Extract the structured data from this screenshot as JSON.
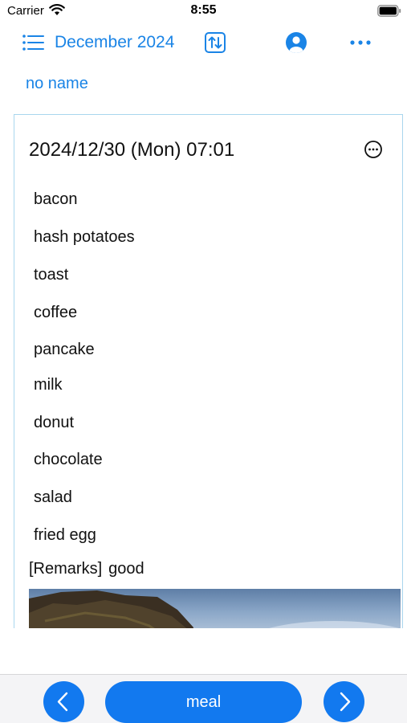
{
  "status_bar": {
    "carrier": "Carrier",
    "time": "8:55"
  },
  "header": {
    "month_title": "December 2024",
    "icons": [
      "list-icon",
      "sort-icon",
      "person-icon",
      "more-icon"
    ]
  },
  "name_link": "no name",
  "entry": {
    "datetime": "2024/12/30 (Mon) 07:01",
    "items": [
      "bacon",
      "hash potatoes",
      "toast",
      "coffee",
      "pancake",
      "milk",
      "donut",
      "chocolate",
      "salad",
      "fried egg"
    ],
    "remarks_label": "[Remarks]",
    "remarks_value": "good"
  },
  "bottom_bar": {
    "center_label": "meal",
    "prev_icon": "chevron-left-icon",
    "next_icon": "chevron-right-icon"
  },
  "colors": {
    "accent": "#1a84e6",
    "button": "#1279ef",
    "card_border": "#a9d6ee",
    "bar_background": "#f4f4f6"
  }
}
